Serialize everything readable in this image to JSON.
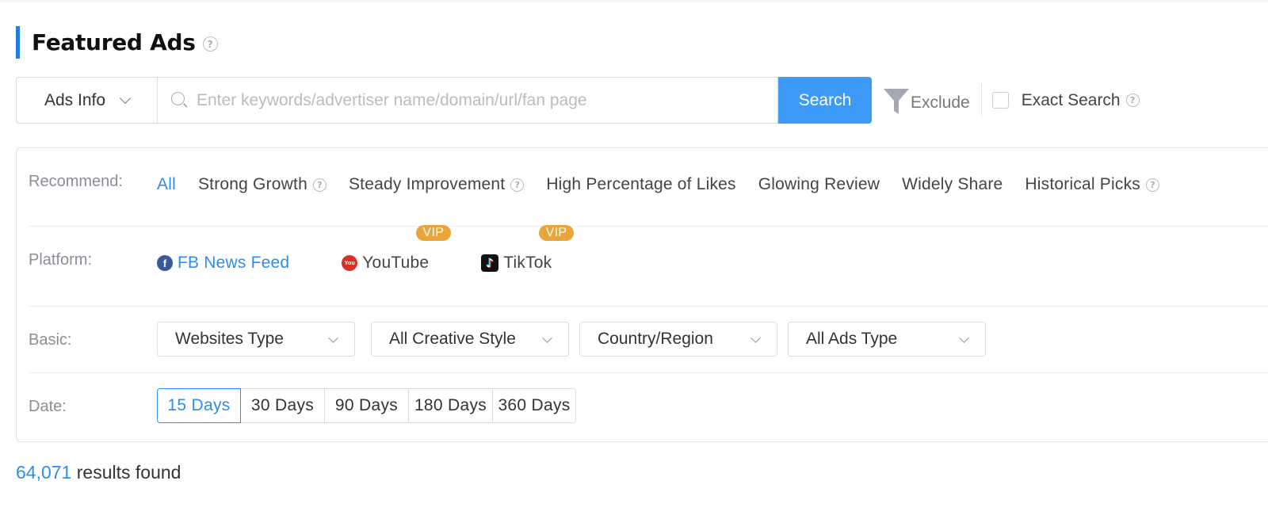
{
  "header": {
    "title": "Featured Ads",
    "help_icon": "?"
  },
  "search": {
    "scope_label": "Ads Info",
    "placeholder": "Enter keywords/advertiser name/domain/url/fan page",
    "value": "",
    "button_label": "Search",
    "exclude_label": "Exclude",
    "exact_search_label": "Exact Search",
    "exact_search_checked": false
  },
  "filters": {
    "recommend": {
      "label": "Recommend:",
      "items": [
        {
          "label": "All",
          "active": true,
          "help": false
        },
        {
          "label": "Strong Growth",
          "active": false,
          "help": true
        },
        {
          "label": "Steady Improvement",
          "active": false,
          "help": true
        },
        {
          "label": "High Percentage of Likes",
          "active": false,
          "help": false
        },
        {
          "label": "Glowing Review",
          "active": false,
          "help": false
        },
        {
          "label": "Widely Share",
          "active": false,
          "help": false
        },
        {
          "label": "Historical Picks",
          "active": false,
          "help": true
        }
      ]
    },
    "platform": {
      "label": "Platform:",
      "items": [
        {
          "label": "FB News Feed",
          "icon": "facebook-icon",
          "icon_text": "f",
          "active": true
        },
        {
          "label": "YouTube",
          "icon": "youtube-icon",
          "icon_text": "You",
          "active": false,
          "badge": "VIP"
        },
        {
          "label": "TikTok",
          "icon": "tiktok-icon",
          "icon_text": "♪",
          "active": false,
          "badge": "VIP"
        }
      ]
    },
    "basic": {
      "label": "Basic:",
      "dropdowns": [
        {
          "label": "Websites Type"
        },
        {
          "label": "All Creative Style"
        },
        {
          "label": "Country/Region"
        },
        {
          "label": "All Ads Type"
        }
      ]
    },
    "date": {
      "label": "Date:",
      "options": [
        {
          "label": "15 Days",
          "active": true
        },
        {
          "label": "30 Days",
          "active": false
        },
        {
          "label": "90 Days",
          "active": false
        },
        {
          "label": "180 Days",
          "active": false
        },
        {
          "label": "360 Days",
          "active": false
        }
      ]
    }
  },
  "results": {
    "count": "64,071",
    "suffix": " results found"
  },
  "colors": {
    "accent": "#2d8cf0",
    "search_button": "#3d9bf7",
    "title_bar": "#1e7fe0",
    "vip_badge": "#e9a53a"
  }
}
